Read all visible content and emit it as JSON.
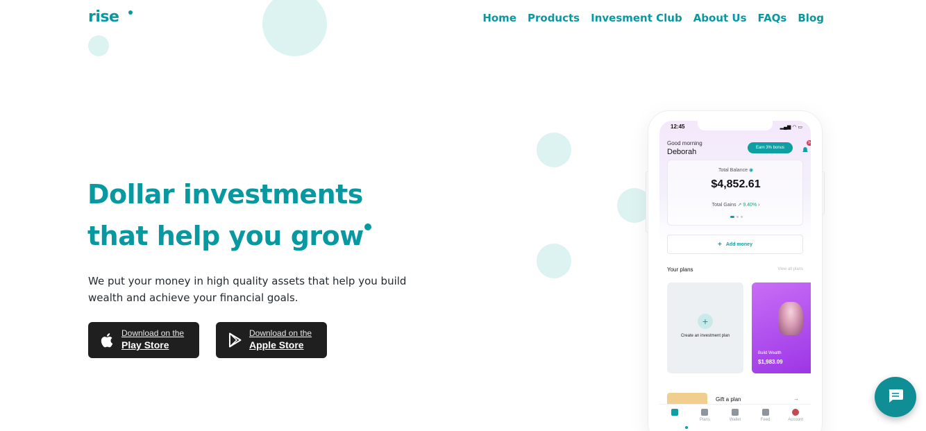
{
  "header": {
    "logo": "rise",
    "nav": [
      "Home",
      "Products",
      "Invesment Club",
      "About Us",
      "FAQs",
      "Blog"
    ]
  },
  "hero": {
    "title_line1": "Dollar investments",
    "title_line2_a": "that help you",
    "title_line2_b": "grow",
    "subtitle": "We put your money in high quality assets that help you build wealth and achieve your financial goals.",
    "buttons": [
      {
        "small": "Download on the",
        "big": "Play Store",
        "icon": "apple-icon"
      },
      {
        "small": "Download on the",
        "big": "Apple Store",
        "icon": "play-icon"
      }
    ]
  },
  "phone": {
    "time": "12:45",
    "greeting": "Good morning",
    "user_name": "Deborah",
    "bonus_label": "Earn 3% bonus",
    "badge": "9+",
    "total_balance_label": "Total Balance",
    "total_balance_value": "$4,852.61",
    "total_gains_label": "Total Gains",
    "total_gains_value": "9.40%",
    "add_money_label": "Add money",
    "your_plans_label": "Your plans",
    "view_all_label": "View all plans",
    "create_plan_label": "Create an investment plan",
    "wealth_plan_label": "Build Wealth",
    "wealth_plan_value": "$1,983.09",
    "gift_label": "Gift a plan",
    "tabs": [
      "Home",
      "Plans",
      "Wallet",
      "Feed",
      "Account"
    ]
  },
  "colors": {
    "brand": "#0898a0",
    "circle": "#dcf3f2",
    "store_button": "#1f1f1f"
  }
}
